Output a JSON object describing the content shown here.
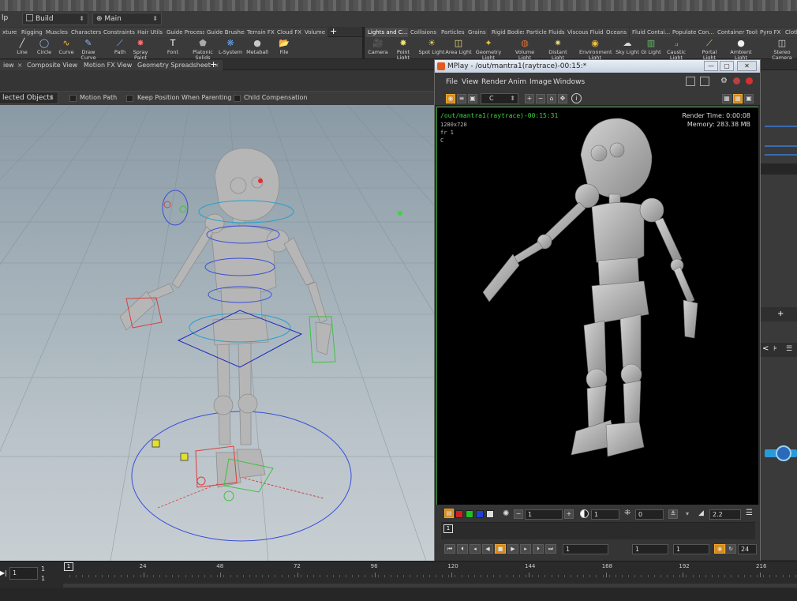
{
  "menu": {
    "help_label": "lp",
    "desktop_label": "Build",
    "main_label": "Main"
  },
  "shelf_left": {
    "tabs": [
      "xture",
      "Rigging",
      "Muscles",
      "Characters",
      "Constraints",
      "Hair Utils",
      "Guide Process",
      "Guide Brushes",
      "Terrain FX",
      "Cloud FX",
      "Volume"
    ],
    "tools": [
      "Line",
      "Circle",
      "Curve",
      "Draw Curve",
      "Path",
      "Spray Paint",
      "Font",
      "Platonic Solids",
      "L-System",
      "Metaball",
      "File"
    ]
  },
  "shelf_right": {
    "tabs": [
      "Lights and C...",
      "Collisions",
      "Particles",
      "Grains",
      "Rigid Bodies",
      "Particle Fluids",
      "Viscous Fluids",
      "Oceans",
      "Fluid Contai...",
      "Populate Con...",
      "Container Tools",
      "Pyro FX",
      "Cloth"
    ],
    "tools": [
      "Camera",
      "Point Light",
      "Spot Light",
      "Area Light",
      "Geometry Light",
      "Volume Light",
      "Distant Light",
      "Environment Light",
      "Sky Light",
      "GI Light",
      "Caustic Light",
      "Portal Light",
      "Ambient Light",
      "Stereo Camera"
    ]
  },
  "pane_tabs": [
    "iew",
    "Composite View",
    "Motion FX View",
    "Geometry Spreadsheet"
  ],
  "viewport": {
    "select_mode": "lected Objects",
    "options": [
      "Motion Path",
      "Keep Position When Parenting",
      "Child Compensation"
    ]
  },
  "mplay": {
    "title": "MPlay - /out/mantra1(raytrace)-00:15:*",
    "menus": [
      "File",
      "View",
      "Render",
      "Anim",
      "Image",
      "Windows"
    ],
    "channel": "C",
    "info_path": "/out/mantra1(raytrace)-00:15:31",
    "resolution": "1280x720",
    "frame_label": "fr 1",
    "channel_label": "C",
    "render_time": "Render Time: 0:00:08",
    "memory": "Memory:   283.38 MB",
    "exposure": "1",
    "gamma_field": "1",
    "offset_field": "0",
    "gamma": "2.2",
    "frame_marker": "1",
    "playback_frame": "1",
    "range_start": "1",
    "range_end": "1",
    "fps": "24"
  },
  "timeline": {
    "current_frame": "1",
    "start_field_a": "1",
    "start_field_b": "1",
    "start_field_c": "1",
    "marker": "1",
    "ticks": [
      "24",
      "48",
      "72",
      "96",
      "120",
      "144",
      "168",
      "192",
      "216"
    ]
  },
  "colors": {
    "accent": "#d48a1c",
    "info_green": "#3fd13f",
    "viewport_bg": "#9eacb5"
  }
}
